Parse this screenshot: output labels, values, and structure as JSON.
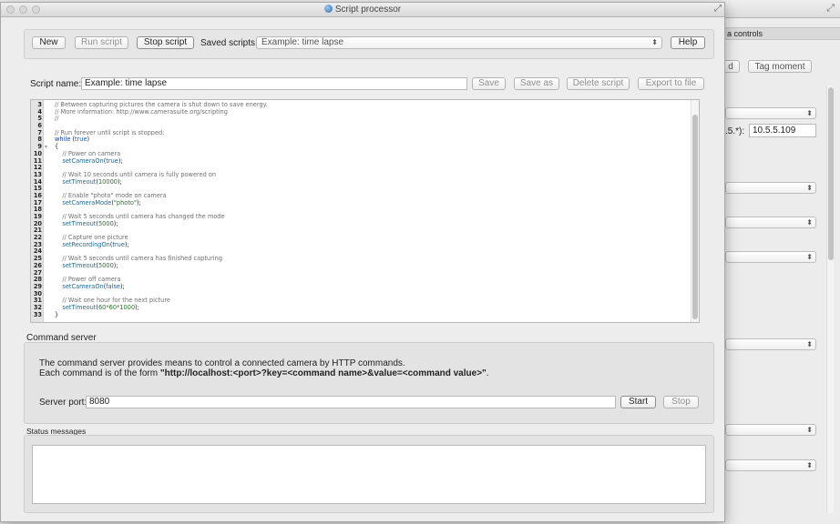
{
  "window": {
    "title": "Script processor"
  },
  "background_window": {
    "tab_label": "a controls",
    "button_partial_label": "d",
    "tag_moment_label": "Tag moment",
    "ip_label": ".5.*):",
    "ip_value": "10.5.5.109"
  },
  "toolbar": {
    "new_label": "New",
    "run_label": "Run script",
    "stop_label": "Stop script",
    "saved_scripts_label": "Saved scripts:",
    "saved_scripts_value": "Example: time lapse",
    "help_label": "Help"
  },
  "script_name": {
    "label": "Script name:",
    "value": "Example: time lapse",
    "save_label": "Save",
    "save_as_label": "Save as",
    "delete_label": "Delete script",
    "export_label": "Export to file"
  },
  "editor": {
    "lines": [
      {
        "n": "3",
        "fold": "",
        "tokens": [
          {
            "t": "// Between capturing pictures the camera is shut down to save energy.",
            "c": "c-comment"
          }
        ]
      },
      {
        "n": "4",
        "fold": "",
        "tokens": [
          {
            "t": "// More information: http://www.camerasuite.org/scripting",
            "c": "c-comment"
          }
        ]
      },
      {
        "n": "5",
        "fold": "",
        "tokens": [
          {
            "t": "//",
            "c": "c-comment"
          }
        ]
      },
      {
        "n": "6",
        "fold": "",
        "tokens": []
      },
      {
        "n": "7",
        "fold": "",
        "tokens": [
          {
            "t": "// Run forever until script is stopped:",
            "c": "c-comment"
          }
        ]
      },
      {
        "n": "8",
        "fold": "",
        "tokens": [
          {
            "t": "while",
            "c": "c-kw"
          },
          {
            "t": " (",
            "c": "c-plain"
          },
          {
            "t": "true",
            "c": "c-lit"
          },
          {
            "t": ")",
            "c": "c-plain"
          }
        ]
      },
      {
        "n": "9",
        "fold": "▾",
        "tokens": [
          {
            "t": "{",
            "c": "c-plain"
          }
        ]
      },
      {
        "n": "10",
        "fold": "",
        "tokens": [
          {
            "t": "    // Power on camera",
            "c": "c-comment"
          }
        ]
      },
      {
        "n": "11",
        "fold": "",
        "tokens": [
          {
            "t": "    setCameraOn",
            "c": "c-fn"
          },
          {
            "t": "(",
            "c": "c-plain"
          },
          {
            "t": "true",
            "c": "c-lit"
          },
          {
            "t": ");",
            "c": "c-plain"
          }
        ]
      },
      {
        "n": "12",
        "fold": "",
        "tokens": []
      },
      {
        "n": "13",
        "fold": "",
        "tokens": [
          {
            "t": "    // Wait 10 seconds until camera is fully powered on",
            "c": "c-comment"
          }
        ]
      },
      {
        "n": "14",
        "fold": "",
        "tokens": [
          {
            "t": "    setTimeout",
            "c": "c-fn"
          },
          {
            "t": "(",
            "c": "c-plain"
          },
          {
            "t": "10000",
            "c": "c-str"
          },
          {
            "t": ");",
            "c": "c-plain"
          }
        ]
      },
      {
        "n": "15",
        "fold": "",
        "tokens": []
      },
      {
        "n": "16",
        "fold": "",
        "tokens": [
          {
            "t": "    // Enable \"photo\" mode on camera",
            "c": "c-comment"
          }
        ]
      },
      {
        "n": "17",
        "fold": "",
        "tokens": [
          {
            "t": "    setCameraMode",
            "c": "c-fn"
          },
          {
            "t": "(",
            "c": "c-plain"
          },
          {
            "t": "\"photo\"",
            "c": "c-str"
          },
          {
            "t": ");",
            "c": "c-plain"
          }
        ]
      },
      {
        "n": "18",
        "fold": "",
        "tokens": []
      },
      {
        "n": "19",
        "fold": "",
        "tokens": [
          {
            "t": "    // Wait 5 seconds until camera has changed the mode",
            "c": "c-comment"
          }
        ]
      },
      {
        "n": "20",
        "fold": "",
        "tokens": [
          {
            "t": "    setTimeout",
            "c": "c-fn"
          },
          {
            "t": "(",
            "c": "c-plain"
          },
          {
            "t": "5000",
            "c": "c-str"
          },
          {
            "t": ");",
            "c": "c-plain"
          }
        ]
      },
      {
        "n": "21",
        "fold": "",
        "tokens": []
      },
      {
        "n": "22",
        "fold": "",
        "tokens": [
          {
            "t": "    // Capture one picture",
            "c": "c-comment"
          }
        ]
      },
      {
        "n": "23",
        "fold": "",
        "tokens": [
          {
            "t": "    setRecordingOn",
            "c": "c-fn"
          },
          {
            "t": "(",
            "c": "c-plain"
          },
          {
            "t": "true",
            "c": "c-lit"
          },
          {
            "t": ");",
            "c": "c-plain"
          }
        ]
      },
      {
        "n": "24",
        "fold": "",
        "tokens": []
      },
      {
        "n": "25",
        "fold": "",
        "tokens": [
          {
            "t": "    // Wait 5 seconds until camera has finished capturing",
            "c": "c-comment"
          }
        ]
      },
      {
        "n": "26",
        "fold": "",
        "tokens": [
          {
            "t": "    setTimeout",
            "c": "c-fn"
          },
          {
            "t": "(",
            "c": "c-plain"
          },
          {
            "t": "5000",
            "c": "c-str"
          },
          {
            "t": ");",
            "c": "c-plain"
          }
        ]
      },
      {
        "n": "27",
        "fold": "",
        "tokens": []
      },
      {
        "n": "28",
        "fold": "",
        "tokens": [
          {
            "t": "    // Power off camera",
            "c": "c-comment"
          }
        ]
      },
      {
        "n": "29",
        "fold": "",
        "tokens": [
          {
            "t": "    setCameraOn",
            "c": "c-fn"
          },
          {
            "t": "(",
            "c": "c-plain"
          },
          {
            "t": "false",
            "c": "c-lit"
          },
          {
            "t": ");",
            "c": "c-plain"
          }
        ]
      },
      {
        "n": "30",
        "fold": "",
        "tokens": []
      },
      {
        "n": "31",
        "fold": "",
        "tokens": [
          {
            "t": "    // Wait one hour for the next picture",
            "c": "c-comment"
          }
        ]
      },
      {
        "n": "32",
        "fold": "",
        "tokens": [
          {
            "t": "    setTimeout",
            "c": "c-fn"
          },
          {
            "t": "(",
            "c": "c-plain"
          },
          {
            "t": "60*60*1000",
            "c": "c-str"
          },
          {
            "t": ");",
            "c": "c-plain"
          }
        ]
      },
      {
        "n": "33",
        "fold": "",
        "tokens": [
          {
            "t": "}",
            "c": "c-plain"
          }
        ]
      }
    ]
  },
  "command_server": {
    "title": "Command server",
    "desc_line1": "The command server provides means to control a connected camera by HTTP commands.",
    "desc_line2_prefix": "Each command is of the form ",
    "desc_line2_bold": "\"http://localhost:<port>?key=<command name>&value=<command value>\"",
    "desc_line2_suffix": ".",
    "port_label": "Server port:",
    "port_value": "8080",
    "start_label": "Start",
    "stop_label": "Stop"
  },
  "status": {
    "title": "Status messages"
  }
}
